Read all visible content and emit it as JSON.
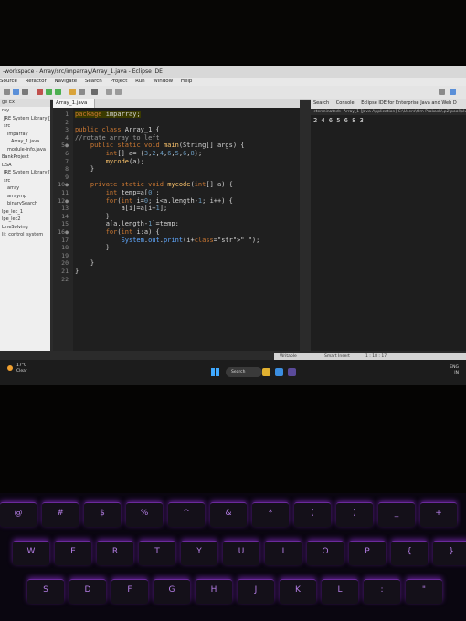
{
  "window": {
    "title": "-workspace - Array/src/imparray/Array_1.java - Eclipse IDE"
  },
  "menu": [
    "Source",
    "Refactor",
    "Navigate",
    "Search",
    "Project",
    "Run",
    "Window",
    "Help"
  ],
  "package_explorer": {
    "tab": "ge Ex",
    "items": [
      "ray",
      "JRE System Library [Jav",
      "src",
      "imparray",
      "Array_1.java",
      "module-info.java",
      "BankProject",
      "DSA",
      "JRE System Library [Jav",
      "src",
      "array",
      "arraymp",
      "binarySearch",
      "lpe_lec_1",
      "lpe_lec2",
      "LineSolving",
      "lit_control_system"
    ]
  },
  "editor": {
    "tab_label": "Array_1.java",
    "lines": [
      {
        "n": "1",
        "text": "package imparray;"
      },
      {
        "n": "2",
        "text": ""
      },
      {
        "n": "3",
        "text": "public class Array_1 {"
      },
      {
        "n": "4",
        "text": "//rotate array to left"
      },
      {
        "n": "5●",
        "text": "    public static void main(String[] args) {"
      },
      {
        "n": "6",
        "text": "        int[] a= {3,2,4,6,5,6,8};"
      },
      {
        "n": "7",
        "text": "        mycode(a);"
      },
      {
        "n": "8",
        "text": "    }"
      },
      {
        "n": "9",
        "text": ""
      },
      {
        "n": "10●",
        "text": "    private static void mycode(int[] a) {"
      },
      {
        "n": "11",
        "text": "        int temp=a[0];"
      },
      {
        "n": "12●",
        "text": "        for(int i=0; i<a.length-1; i++) {"
      },
      {
        "n": "13",
        "text": "            a[i]=a[i+1];"
      },
      {
        "n": "14",
        "text": "        }"
      },
      {
        "n": "15",
        "text": "        a[a.length-1]=temp;"
      },
      {
        "n": "16●",
        "text": "        for(int i:a) {"
      },
      {
        "n": "17",
        "text": "            System.out.print(i+\" \");"
      },
      {
        "n": "18",
        "text": "        }"
      },
      {
        "n": "19",
        "text": ""
      },
      {
        "n": "20",
        "text": "    }"
      },
      {
        "n": "21",
        "text": "}"
      },
      {
        "n": "22",
        "text": ""
      }
    ]
  },
  "right_panel": {
    "tabs": [
      "Search",
      "Console",
      "Eclipse IDE for Enterprise Java and Web D"
    ],
    "terminated_line": "<terminated> Array_1 [Java Application] C:\\Users\\Om Prakash\\.p2\\pool\\plugi",
    "output": "2 4 6 5 6 8 3"
  },
  "status_bar": {
    "mode": "Writable",
    "insert": "Smart Insert",
    "position": "1 : 18 : 17"
  },
  "taskbar": {
    "weather_temp": "17°C",
    "weather_desc": "Clear",
    "search_label": "Search",
    "lang": "ENG",
    "region": "IN"
  },
  "colors": {
    "keyword": "#cc7832",
    "accent_keyboard": "#8a3bd1"
  },
  "keyboard": {
    "row1": [
      "@",
      "#",
      "$",
      "%",
      "^",
      "&",
      "*",
      "(",
      ")",
      "_",
      "+"
    ],
    "row2": [
      "W",
      "E",
      "R",
      "T",
      "Y",
      "U",
      "I",
      "O",
      "P",
      "{",
      "}"
    ],
    "row3": [
      "S",
      "D",
      "F",
      "G",
      "H",
      "J",
      "K",
      "L",
      ":",
      "\""
    ]
  }
}
